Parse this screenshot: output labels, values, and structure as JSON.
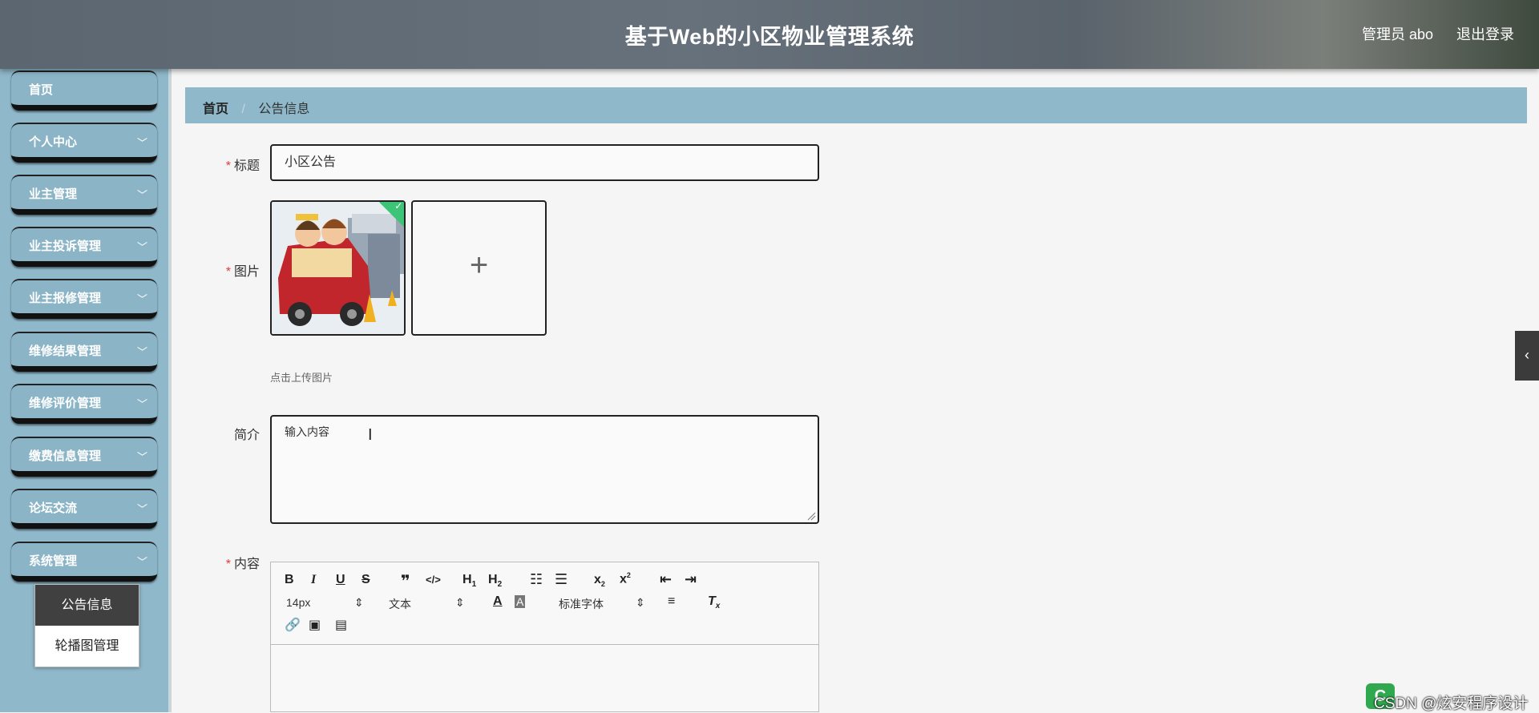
{
  "header": {
    "title": "基于Web的小区物业管理系统",
    "user": "管理员 abo",
    "logout": "退出登录"
  },
  "sidebar": {
    "items": [
      {
        "label": "首页"
      },
      {
        "label": "个人中心"
      },
      {
        "label": "业主管理"
      },
      {
        "label": "业主投诉管理"
      },
      {
        "label": "业主报修管理"
      },
      {
        "label": "维修结果管理"
      },
      {
        "label": "维修评价管理"
      },
      {
        "label": "缴费信息管理"
      },
      {
        "label": "论坛交流"
      },
      {
        "label": "系统管理"
      }
    ],
    "submenu": [
      {
        "label": "公告信息",
        "active": true
      },
      {
        "label": "轮播图管理",
        "active": false
      }
    ]
  },
  "breadcrumb": {
    "home": "首页",
    "separator": "/",
    "current": "公告信息"
  },
  "form": {
    "title_label": "标题",
    "title_value": "小区公告",
    "image_label": "图片",
    "upload_hint": "点击上传图片",
    "intro_label": "简介",
    "intro_value": "输入内容",
    "content_label": "内容",
    "required_mark": "*"
  },
  "editor": {
    "font_size": "14px",
    "paragraph": "文本",
    "font_family": "标准字体"
  },
  "watermark": "CSDN @炫安程序设计",
  "colors": {
    "accent": "#8fb8ca",
    "header": "#5c6670",
    "required": "#e23b3b",
    "success": "#3ec477"
  }
}
